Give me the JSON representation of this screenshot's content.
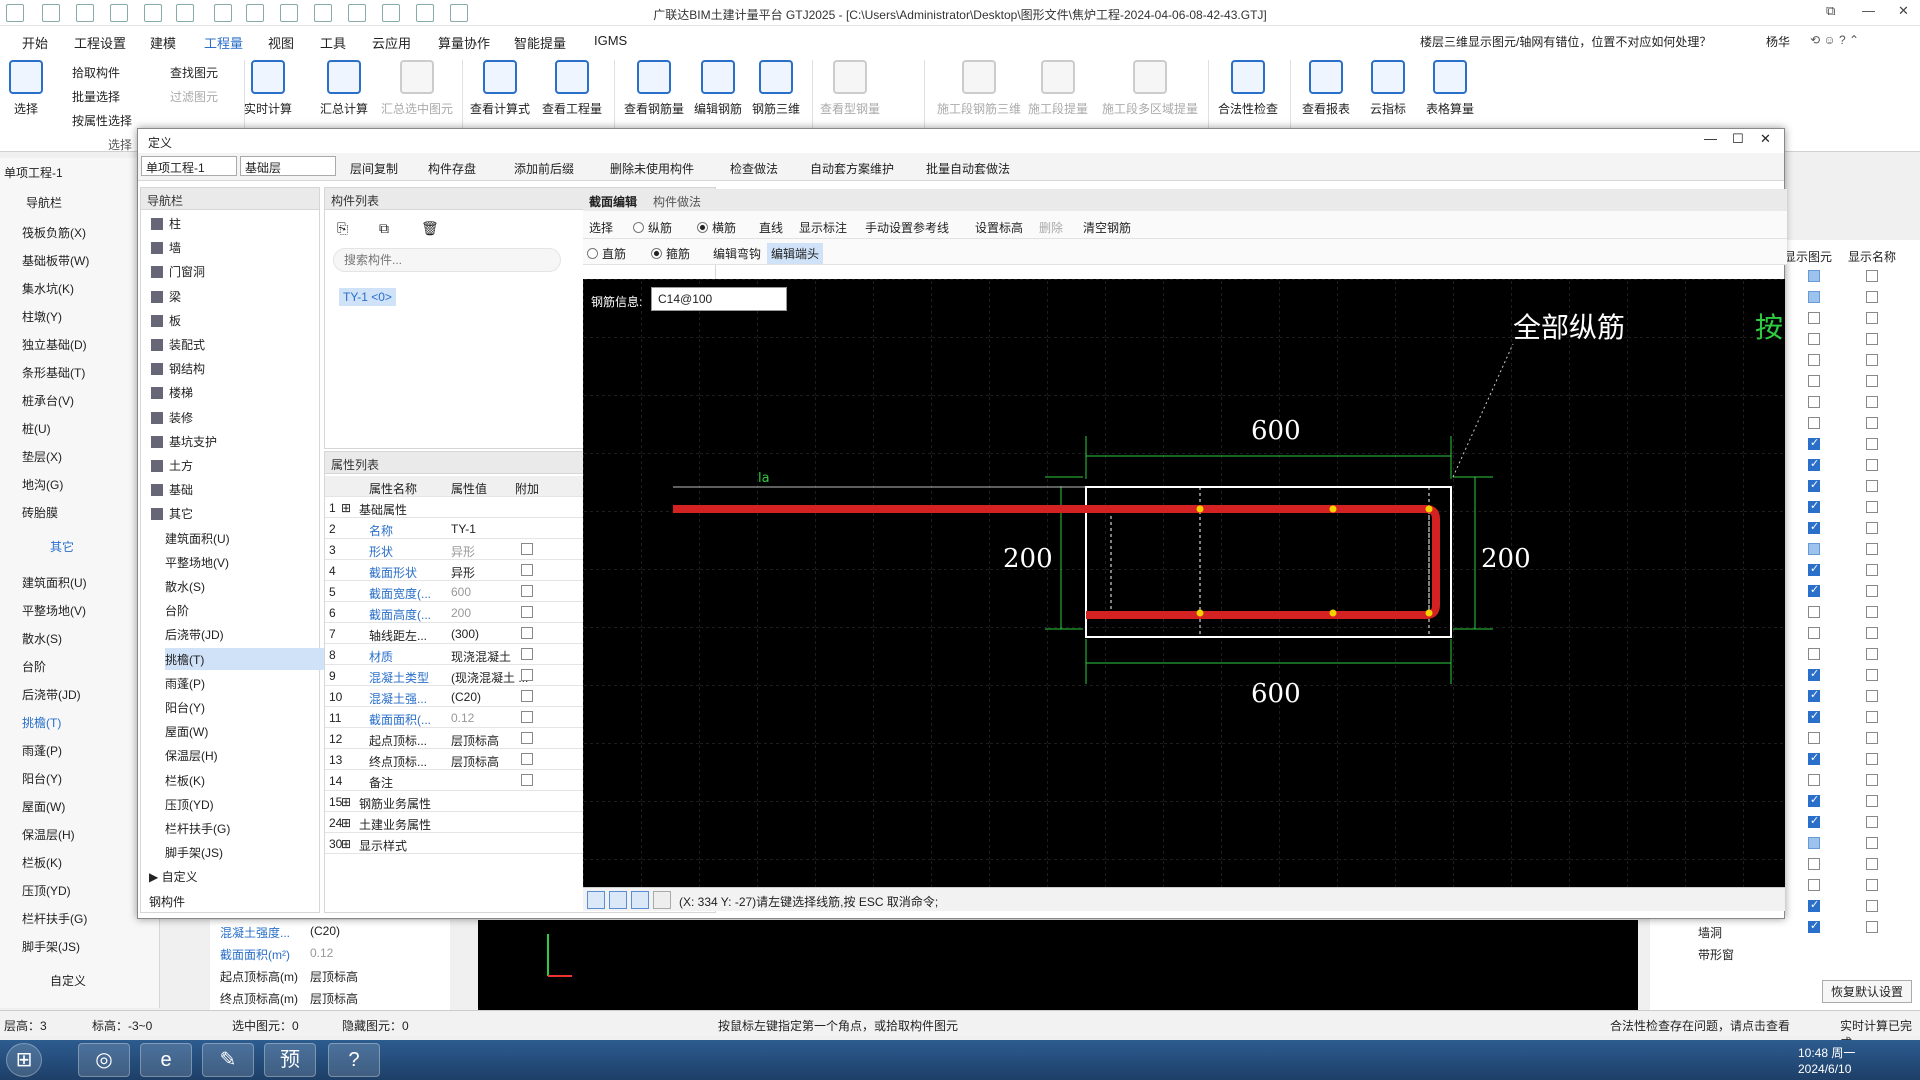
{
  "window": {
    "title": "广联达BIM土建计量平台 GTJ2025 - [C:\\Users\\Administrator\\Desktop\\图形文件\\焦炉工程-2024-04-06-08-42-43.GTJ]",
    "help_text": "楼层三维显示图元/轴网有错位，位置不对应如何处理？",
    "user": "杨华"
  },
  "menu": [
    "开始",
    "工程设置",
    "建模",
    "工程量",
    "视图",
    "工具",
    "云应用",
    "算量协作",
    "智能提量",
    "IGMS"
  ],
  "ribbon": {
    "select": "选择",
    "pick": "拾取构件",
    "batch_select": "批量选择",
    "by_attr": "按属性选择",
    "find": "查找图元",
    "filter": "过滤图元",
    "group_select": "选择",
    "realtime": "实时计算",
    "summary": "汇总计算",
    "summary_sel": "汇总选中图元",
    "view_formula": "查看计算式",
    "view_qty": "查看工程量",
    "view_rebar": "查看钢筋量",
    "edit_rebar": "编辑钢筋",
    "rebar_3d": "钢筋三维",
    "view_steel": "查看型钢量",
    "seg_3d": "施工段钢筋三维",
    "seg_qty": "施工段提量",
    "seg_multi": "施工段多区域提量",
    "legal_check": "合法性检查",
    "view_report": "查看报表",
    "cloud_index": "云指标",
    "table_calc": "表格算量"
  },
  "left_panel": {
    "project": "单项工程-1",
    "layer": "基础层",
    "nav_title": "导航栏",
    "items": [
      "筏板负筋(X)",
      "基础板带(W)",
      "集水坑(K)",
      "柱墩(Y)",
      "独立基础(D)",
      "条形基础(T)",
      "桩承台(V)",
      "桩(U)",
      "垫层(X)",
      "地沟(G)",
      "砖胎膜"
    ],
    "other": "其它",
    "other_items": [
      "建筑面积(U)",
      "平整场地(V)",
      "散水(S)",
      "台阶",
      "后浇带(JD)",
      "挑檐(T)",
      "雨蓬(P)",
      "阳台(Y)",
      "屋面(W)",
      "保温层(H)",
      "栏板(K)",
      "压顶(YD)",
      "栏杆扶手(G)",
      "脚手架(JS)"
    ],
    "custom": "自定义"
  },
  "dialog": {
    "title": "定义",
    "project": "单项工程-1",
    "layer": "基础层",
    "toolbar": [
      "层间复制",
      "构件存盘",
      "添加前后缀",
      "删除未使用构件",
      "检查做法",
      "自动套方案维护",
      "批量自动套做法"
    ],
    "nav_title": "导航栏",
    "nav_items": [
      "柱",
      "墙",
      "门窗洞",
      "梁",
      "板",
      "装配式",
      "钢结构",
      "楼梯",
      "装修",
      "基坑支护",
      "土方",
      "基础",
      "其它"
    ],
    "nav_sub": [
      "建筑面积(U)",
      "平整场地(V)",
      "散水(S)",
      "台阶",
      "后浇带(JD)",
      "挑檐(T)",
      "雨蓬(P)",
      "阳台(Y)",
      "屋面(W)",
      "保温层(H)",
      "栏板(K)",
      "压顶(YD)",
      "栏杆扶手(G)",
      "脚手架(JS)"
    ],
    "nav_custom": "自定义",
    "nav_rebar_comp": "钢构件",
    "comp_list_title": "构件列表",
    "search_placeholder": "搜索构件...",
    "component": "TY-1 <0>",
    "attr_title": "属性列表",
    "attr_headers": [
      "属性名称",
      "属性值",
      "附加"
    ],
    "attrs": [
      {
        "no": "1",
        "name": "基础属性",
        "value": "",
        "group": true
      },
      {
        "no": "2",
        "name": "名称",
        "value": "TY-1"
      },
      {
        "no": "3",
        "name": "形状",
        "value": "异形",
        "gray": true
      },
      {
        "no": "4",
        "name": "截面形状",
        "value": "异形"
      },
      {
        "no": "5",
        "name": "截面宽度(...",
        "value": "600",
        "gray": true
      },
      {
        "no": "6",
        "name": "截面高度(...",
        "value": "200",
        "gray": true
      },
      {
        "no": "7",
        "name": "轴线距左...",
        "value": "(300)",
        "black": true
      },
      {
        "no": "8",
        "name": "材质",
        "value": "现浇混凝土"
      },
      {
        "no": "9",
        "name": "混凝土类型",
        "value": "(现浇混凝土 ..."
      },
      {
        "no": "10",
        "name": "混凝土强...",
        "value": "(C20)"
      },
      {
        "no": "11",
        "name": "截面面积(...",
        "value": "0.12",
        "gray": true
      },
      {
        "no": "12",
        "name": "起点顶标...",
        "value": "层顶标高",
        "black": true
      },
      {
        "no": "13",
        "name": "终点顶标...",
        "value": "层顶标高",
        "black": true
      },
      {
        "no": "14",
        "name": "备注",
        "value": "",
        "black": true
      },
      {
        "no": "15",
        "name": "钢筋业务属性",
        "value": "",
        "group": true
      },
      {
        "no": "24",
        "name": "土建业务属性",
        "value": "",
        "group": true
      },
      {
        "no": "30",
        "name": "显示样式",
        "value": "",
        "group": true
      }
    ],
    "tabs": [
      "截面编辑",
      "构件做法"
    ],
    "canvas_tools": [
      "选择",
      "纵筋",
      "横筋",
      "直线",
      "显示标注",
      "手动设置参考线",
      "设置标高",
      "删除",
      "清空钢筋"
    ],
    "canvas_tools2": [
      "直筋",
      "箍筋",
      "编辑弯钩",
      "编辑端头"
    ],
    "rebar_info_label": "钢筋信息:",
    "rebar_info": "C14@100",
    "all_longitudinal": "全部纵筋",
    "press": "按",
    "dims": {
      "top": "600",
      "bottom": "600",
      "left": "200",
      "right": "200",
      "la": "la"
    },
    "status": "(X: 334 Y: -27)请左键选择线筋,按 ESC 取消命令;"
  },
  "right_panel": {
    "col1": "显示图元",
    "col2": "显示名称",
    "rows": [
      "墙洞",
      "带形窗"
    ],
    "reset": "恢复默认设置"
  },
  "under_dialog": {
    "rows": [
      {
        "name": "混凝土强度...",
        "value": "(C20)"
      },
      {
        "name": "截面面积(m²)",
        "value": "0.12"
      },
      {
        "name": "起点顶标高(m)",
        "value": "层顶标高"
      },
      {
        "name": "终点顶标高(m)",
        "value": "层顶标高"
      }
    ]
  },
  "statusbar": {
    "floor": "层高：3",
    "elev": "标高：-3~0",
    "selected": "选中图元：0",
    "hidden": "隐藏图元：0",
    "hint": "按鼠标左键指定第一个角点，或拾取构件图元",
    "warn": "合法性检查存在问题，请点击查看",
    "done": "实时计算已完成"
  },
  "taskbar": {
    "time": "10:48 周一",
    "date": "2024/6/10",
    "app_pre": "预"
  }
}
